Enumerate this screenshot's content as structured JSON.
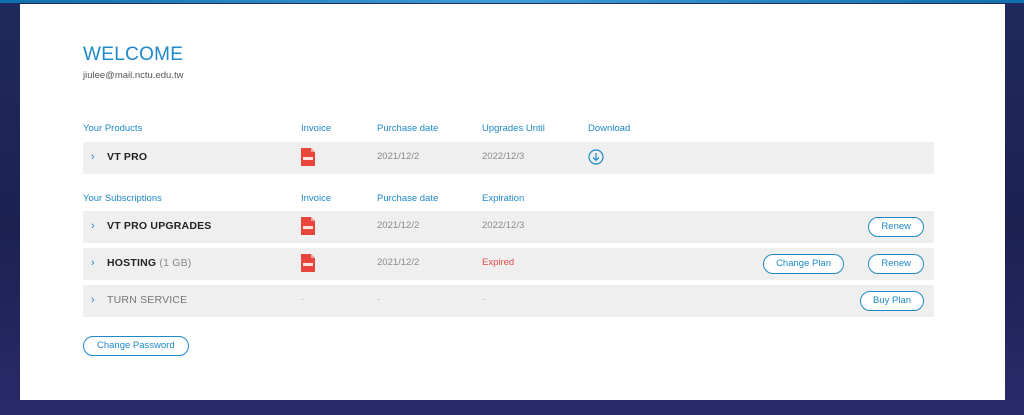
{
  "header": {
    "title": "WELCOME",
    "email": "jiulee@mail.nctu.edu.tw"
  },
  "products": {
    "columns": [
      "Your Products",
      "Invoice",
      "Purchase date",
      "Upgrades Until",
      "Download"
    ],
    "rows": [
      {
        "name": "VT PRO",
        "purchase_date": "2021/12/2",
        "until": "2022/12/3"
      }
    ]
  },
  "subscriptions": {
    "columns": [
      "Your Subscriptions",
      "Invoice",
      "Purchase date",
      "Expiration"
    ],
    "rows": [
      {
        "name": "VT PRO UPGRADES",
        "purchase_date": "2021/12/2",
        "expiration": "2022/12/3",
        "actions": [
          "Renew"
        ]
      },
      {
        "name": "HOSTING",
        "sub": "(1 GB)",
        "purchase_date": "2021/12/2",
        "expiration": "Expired",
        "actions": [
          "Change Plan",
          "Renew"
        ]
      },
      {
        "name": "TURN SERVICE",
        "invoice": "-",
        "purchase_date": "-",
        "expiration": "-",
        "actions": [
          "Buy Plan"
        ]
      }
    ]
  },
  "footer": {
    "change_password": "Change Password"
  },
  "icons": {
    "expand": "chevron-right-icon",
    "invoice": "pdf-icon",
    "download": "download-icon"
  },
  "colors": {
    "accent": "#1e88c8",
    "expired": "#e14b4b",
    "pdf": "#e8463c",
    "row_bg": "#efefef"
  }
}
